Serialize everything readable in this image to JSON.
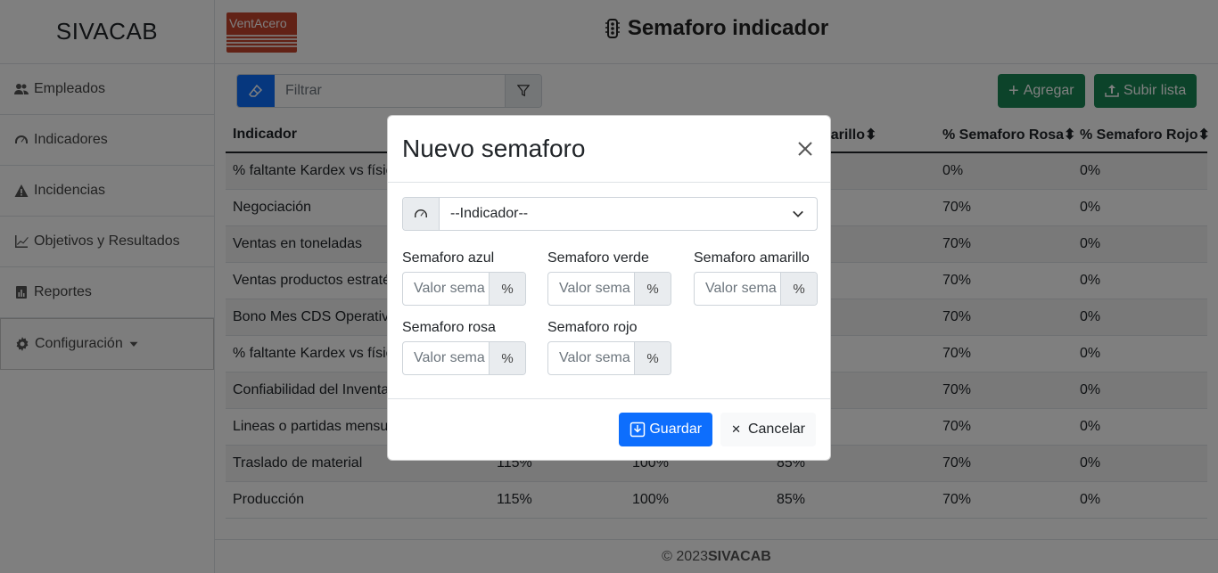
{
  "app": {
    "brand": "SIVACAB",
    "page_title": "Semaforo indicador",
    "logo_text": "VentAcero"
  },
  "sidebar": {
    "items": [
      {
        "label": "Empleados",
        "icon": "users-icon"
      },
      {
        "label": "Indicadores",
        "icon": "speedometer-icon"
      },
      {
        "label": "Incidencias",
        "icon": "warning-icon"
      },
      {
        "label": "Objetivos y Resultados",
        "icon": "line-chart-icon"
      },
      {
        "label": "Reportes",
        "icon": "report-icon"
      },
      {
        "label": "Configuración",
        "icon": "gear-icon"
      }
    ]
  },
  "toolbar": {
    "filter_placeholder": "Filtrar",
    "add_label": "Agregar",
    "upload_label": "Subir lista"
  },
  "table": {
    "headers": [
      "Indicador",
      "",
      "",
      "foro Amarillo",
      "% Semaforo Rosa",
      "% Semaforo Rojo"
    ],
    "rows": [
      [
        "% faltante Kardex vs físic",
        "",
        "",
        "",
        "0%",
        "0%"
      ],
      [
        "Negociación",
        "",
        "",
        "",
        "70%",
        "0%"
      ],
      [
        "Ventas en toneladas",
        "",
        "",
        "",
        "70%",
        "0%"
      ],
      [
        "Ventas productos estraté",
        "",
        "",
        "",
        "70%",
        "0%"
      ],
      [
        "Bono Mes CDS Operativo",
        "",
        "",
        "",
        "70%",
        "0%"
      ],
      [
        "% faltante Kardex vs físic",
        "",
        "",
        "",
        "70%",
        "0%"
      ],
      [
        "Confiabilidad del Inventa",
        "",
        "",
        "",
        "70%",
        "0%"
      ],
      [
        "Lineas o partidas mensua",
        "",
        "",
        "",
        "70%",
        "0%"
      ],
      [
        "Traslado de material",
        "115%",
        "100%",
        "85%",
        "70%",
        "0%"
      ],
      [
        "Producción",
        "115%",
        "100%",
        "85%",
        "70%",
        "0%"
      ]
    ]
  },
  "footer": {
    "prefix": "© 2023 ",
    "brand": "SIVACAB"
  },
  "modal": {
    "title": "Nuevo semaforo",
    "select_value": "--Indicador--",
    "fields": [
      {
        "label": "Semaforo azul",
        "placeholder": "Valor sema",
        "unit": "%"
      },
      {
        "label": "Semaforo verde",
        "placeholder": "Valor sema",
        "unit": "%"
      },
      {
        "label": "Semaforo amarillo",
        "placeholder": "Valor sema",
        "unit": "%"
      },
      {
        "label": "Semaforo rosa",
        "placeholder": "Valor sema",
        "unit": "%"
      },
      {
        "label": "Semaforo rojo",
        "placeholder": "Valor sema",
        "unit": "%"
      }
    ],
    "save_label": "Guardar",
    "cancel_label": "Cancelar"
  },
  "colors": {
    "primary": "#0d6efd",
    "success": "#198754",
    "backdrop": "rgba(0,0,0,0.5)"
  }
}
